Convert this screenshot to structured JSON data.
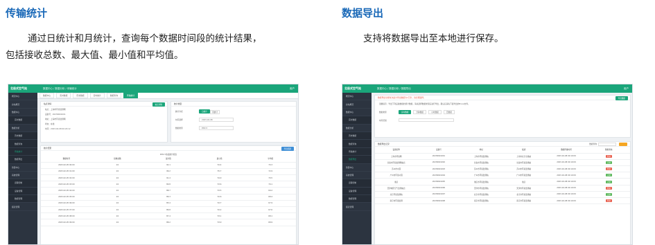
{
  "sections": {
    "stats_title": "传输统计",
    "stats_desc_1": "通过日统计和月统计，查询每个数据时间段的统计结果，",
    "stats_desc_2": "包括接收总数、最大值、最小值和平均值。",
    "export_title": "数据导出",
    "export_desc": "支持将数据导出至本地进行保存。"
  },
  "app": {
    "logo": "北极式空气站",
    "nav": [
      "数据中心",
      "数据分析",
      "传输统计"
    ],
    "nav2": [
      "数据中心",
      "数据分析",
      "数据导出"
    ],
    "user": "用户 "
  },
  "brand": {
    "accent": "#1aa57a",
    "sidebar": "#2c3440",
    "title": "#1a69b8"
  },
  "shot1": {
    "tabs": [
      "数据中心",
      "实时数据",
      "历史数据",
      "实时统计",
      "数据查询",
      "传输统计"
    ],
    "sidebar": [
      "概况中心",
      "总站概况",
      "数据中心",
      "实时数据",
      "数据分析",
      "历史数据",
      "数据查询",
      "传输统计",
      "数据导出",
      "告警中心",
      "系统管理",
      "远程控制",
      "设备管理",
      "数据管理",
      "报表管理"
    ],
    "panel_a": {
      "title": "站点详情",
      "btn": "站点详情",
      "fields": [
        "站点：上海市环境监测网",
        "设备号：20230601001",
        "地址：上海市环境监测网",
        "状态：在线",
        "时间：2023-02-08 00:24:12"
      ]
    },
    "panel_b": {
      "title": "统计类型",
      "labels": [
        "统计方式",
        "时间选择",
        "数据类型"
      ],
      "opts": [
        "日统计",
        "月统计"
      ],
      "date": "2023-02-08",
      "dtype": "PM2.5"
    },
    "table": {
      "title": "统计结果",
      "sub": "PM2.5浓度统计报表",
      "export": "导出结果",
      "headers": [
        "数据时间",
        "接收总数",
        "最大值",
        "最小值",
        "平均值"
      ],
      "rows": [
        [
          "2023-02-05 00:00",
          "24",
          "92.1",
          "52.4",
          "70.3"
        ],
        [
          "2023-02-05 01:00",
          "24",
          "96.2",
          "55.7",
          "72.9"
        ],
        [
          "2023-02-05 02:00",
          "24",
          "91.4",
          "54.9",
          "70.5"
        ],
        [
          "2023-02-05 03:00",
          "24",
          "89.8",
          "53.6",
          "70.1"
        ],
        [
          "2023-02-05 04:00",
          "24",
          "88.7",
          "53.5",
          "69.2"
        ],
        [
          "2023-02-05 05:00",
          "24",
          "86.3",
          "52.6",
          "68.4"
        ],
        [
          "2023-02-05 06:00",
          "24",
          "85.4",
          "52.7",
          "67.9"
        ],
        [
          "2023-02-05 07:00",
          "24",
          "86.8",
          "52.2",
          "67.6"
        ],
        [
          "2023-02-05 08:00",
          "24",
          "87.4",
          "53.1",
          "68.1"
        ],
        [
          "2023-02-05 09:00",
          "24",
          "88.2",
          "53.9",
          "68.9"
        ]
      ]
    }
  },
  "shot2": {
    "notice": "数据导出功能每次最大导出数据为1万条，请合理选择。",
    "tip": "温馨提示：导出下列设备数据的累计数据，请先选择数据类型后进行导出，确认后请先下载导出的Excel文件。",
    "export_btn": "导出数据",
    "labels": [
      "数据类型",
      "时间范围"
    ],
    "opts": [
      "实时数据",
      "分钟数据",
      "小时数据",
      "日数据"
    ],
    "table": {
      "title": "数据导出记录",
      "search": "数据查询",
      "headers": [
        "设备名称",
        "设备号",
        "地址",
        "描述",
        "数据传输时间",
        "数据状态"
      ],
      "rows": [
        [
          "上海市环境网",
          "20230601001",
          "上海市环境监测站",
          "上海市北京东路站",
          "2023-02-08 00:10:09",
          "异常"
        ],
        [
          "长春市环境监测网站点",
          "20230601002",
          "长春市环境监测站",
          "长春市环境监测站",
          "2023-02-08 00:10:09",
          "正常"
        ],
        [
          "苏州市公园",
          "20230601003",
          "苏州市环境监测站",
          "苏州市环境监测站",
          "2023-02-08 00:10:09",
          "异常"
        ],
        [
          "广州市环境公园",
          "20230601004",
          "广州市环境监测站",
          "广州市环境监测站",
          "2023-02-08 00:10:09",
          "正常"
        ],
        [
          "重庆",
          "20230601005",
          "重庆市环境监测站",
          "重庆",
          "2023-02-08 00:10:09",
          "正常"
        ],
        [
          "天津城区空气监测站点",
          "20230601006",
          "天津市环境监测站",
          "天津市环境监测站",
          "2023-02-08 00:10:09",
          "异常"
        ],
        [
          "北京环境监测站",
          "20230601007",
          "北京市环境监测站",
          "北京市环境监测站",
          "2023-02-08 00:10:09",
          "正常"
        ],
        [
          "南京市环境监测",
          "20230601008",
          "南京市环境监测站",
          "南京市环境监测站",
          "2023-02-08 00:10:09",
          "异常"
        ]
      ]
    },
    "sidebar": [
      "概况中心",
      "总站概况",
      "数据中心",
      "实时数据",
      "数据分析",
      "历史数据",
      "数据查询",
      "传输统计",
      "数据导出",
      "告警中心",
      "系统管理",
      "远程控制",
      "设备管理",
      "数据管理",
      "报表管理"
    ]
  }
}
